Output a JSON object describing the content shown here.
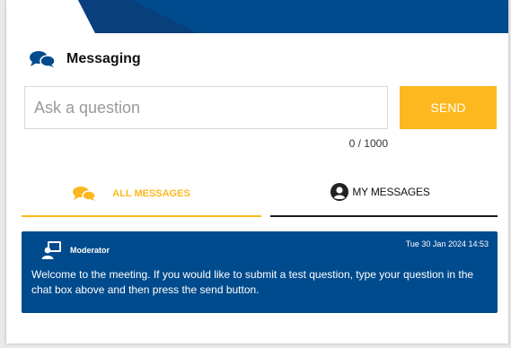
{
  "header": {
    "title": "Messaging",
    "icon": "chat-bubbles-icon"
  },
  "question_form": {
    "placeholder": "Ask a question",
    "value": "",
    "send_label": "SEND",
    "counter": "0 / 1000"
  },
  "tabs": [
    {
      "label": "ALL MESSAGES",
      "icon": "chat-bubbles-icon",
      "active": true
    },
    {
      "label": "MY MESSAGES",
      "icon": "user-circle-icon",
      "active": false
    }
  ],
  "messages": [
    {
      "author": "Moderator",
      "timestamp": "Tue 30 Jan 2024 14:53",
      "text": "Welcome to the meeting. If you would like to submit a test question, type your question in the chat box above and then press the send button.",
      "icon": "moderator-icon"
    }
  ],
  "colors": {
    "brand_blue": "#004b8d",
    "accent_yellow": "#fcb81e",
    "text_dark": "#111111"
  }
}
